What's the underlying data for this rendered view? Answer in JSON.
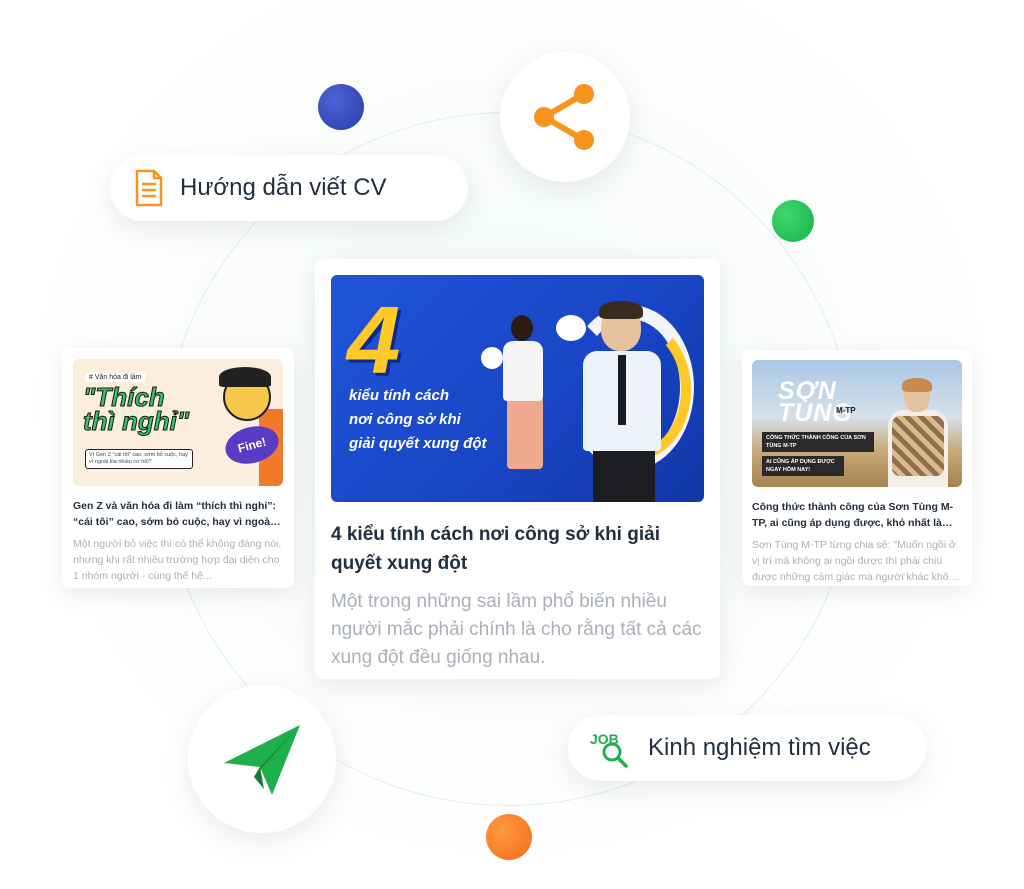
{
  "pills": {
    "cv_label": "Hướng dẫn viết CV",
    "job_label": "Kinh nghiệm tìm việc",
    "job_icon_text": "JOB"
  },
  "icons": {
    "share": "share-icon",
    "send": "paper-plane-icon",
    "document": "document-icon",
    "job_search": "job-search-icon"
  },
  "colors": {
    "primary_green": "#14b14a",
    "accent_orange": "#f7941d",
    "accent_blue": "#2a3ea8",
    "text_dark": "#212f3f",
    "text_muted": "#a9b0b8"
  },
  "main_card": {
    "thumb": {
      "big_number": "4",
      "line1": "kiểu tính cách",
      "line2": "nơi công sở khi",
      "line3": "giải quyết xung đột"
    },
    "title": "4 kiểu tính cách nơi công sở khi giải quyết xung đột",
    "description": "Một trong những sai lầm phổ biến nhiều người mắc phải chính là cho rằng tất cả các xung đột đều giống nhau."
  },
  "left_card": {
    "thumb": {
      "tag": "# Văn hóa đi làm",
      "headline_1": "\"Thích",
      "headline_2": "thì nghỉ\"",
      "note": "Vì Gen Z \"cái tôi\" cao, sớm bỏ cuộc, hay vì ngoài kia nhiều cơ hội?",
      "badge": "Fine!"
    },
    "title": "Gen Z và văn hóa đi làm “thích thì nghỉ”: “cái tôi” cao, sớm bỏ cuộc, hay vì ngoài kia nhiều cơ hội?",
    "description": "Một người bỏ việc thì có thể không đáng nói, nhưng khi rất nhiều trường hợp đại diện cho 1 nhóm người - cùng thế hệ..."
  },
  "right_card": {
    "thumb": {
      "headline_1": "SƠN",
      "headline_2": "TÙNG",
      "suffix": "M-TP",
      "box1": "CÔNG THỨC THÀNH CÔNG CỦA SƠN TÙNG M-TP",
      "box2": "AI CŨNG ÁP DỤNG ĐƯỢC NGAY HÔM NAY!"
    },
    "title": "Công thức thành công của Sơn Tùng M-TP, ai cũng áp dụng được, khỏ nhất là bước đầu tiên",
    "description": "Sơn Tùng M-TP từng chia sẻ: \"Muốn ngồi ở vị trí mà không ai ngồi được thì phải chịu được những cảm giác mà người khác không chịu được\"."
  }
}
